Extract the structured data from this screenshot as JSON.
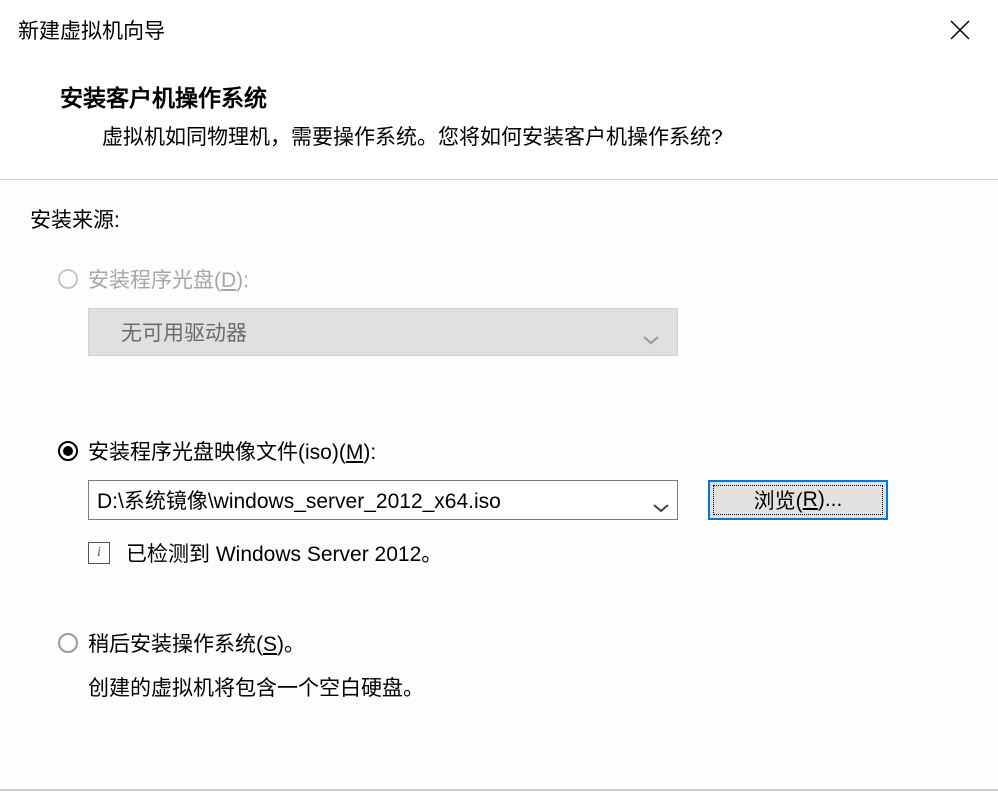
{
  "window": {
    "title": "新建虚拟机向导"
  },
  "header": {
    "title": "安装客户机操作系统",
    "subtitle": "虚拟机如同物理机，需要操作系统。您将如何安装客户机操作系统?"
  },
  "source": {
    "label": "安装来源:",
    "option_disc": {
      "label_prefix": "安装程序光盘(",
      "hotkey": "D",
      "label_suffix": "):",
      "dropdown_value": "无可用驱动器",
      "enabled": false
    },
    "option_iso": {
      "label_prefix": "安装程序光盘映像文件(iso)(",
      "hotkey": "M",
      "label_suffix": "):",
      "path": "D:\\系统镜像\\windows_server_2012_x64.iso",
      "browse_prefix": "浏览(",
      "browse_hotkey": "R",
      "browse_suffix": ")...",
      "detected": "已检测到 Windows Server 2012。",
      "selected": true
    },
    "option_later": {
      "label_prefix": "稍后安装操作系统(",
      "hotkey": "S",
      "label_suffix": ")。",
      "help": "创建的虚拟机将包含一个空白硬盘。"
    }
  }
}
